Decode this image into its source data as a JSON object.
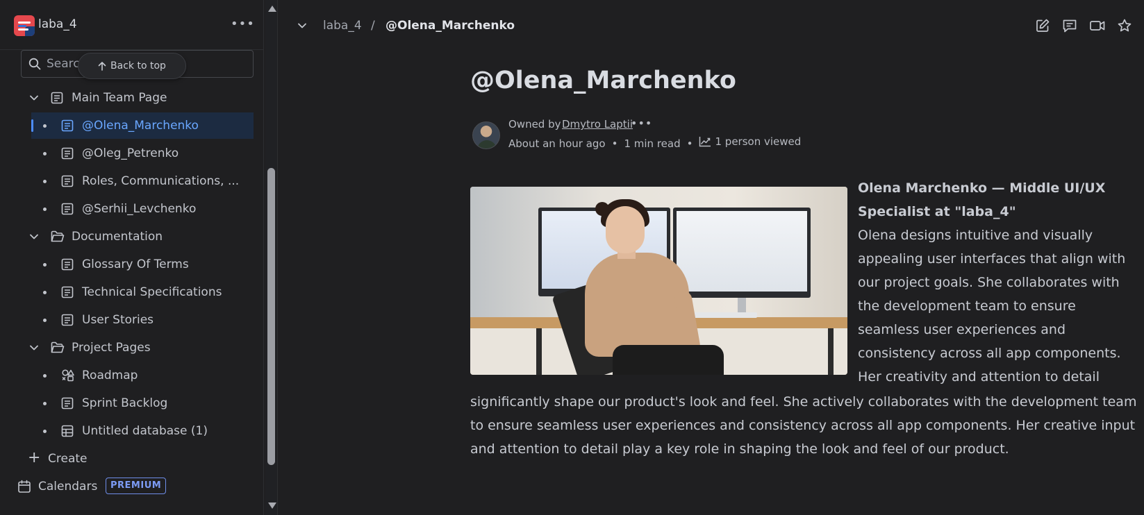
{
  "sidebar": {
    "space_name": "laba_4",
    "more_label": "•••",
    "search_placeholder": "Search",
    "back_to_top": "Back to top",
    "tree": [
      {
        "label": "Main Team Page"
      },
      {
        "label": "@Olena_Marchenko"
      },
      {
        "label": "@Oleg_Petrenko"
      },
      {
        "label": "Roles, Communications, ..."
      },
      {
        "label": "@Serhii_Levchenko"
      },
      {
        "label": "Documentation"
      },
      {
        "label": "Glossary Of Terms"
      },
      {
        "label": "Technical Specifications"
      },
      {
        "label": "User Stories"
      },
      {
        "label": "Project Pages"
      },
      {
        "label": "Roadmap"
      },
      {
        "label": "Sprint Backlog"
      },
      {
        "label": "Untitled database (1)"
      }
    ],
    "create_label": "Create",
    "calendars_label": "Calendars",
    "premium_badge": "PREMIUM"
  },
  "breadcrumb": {
    "space": "laba_4",
    "separator": "/",
    "current": "@Olena_Marchenko"
  },
  "page": {
    "title": "@Olena_Marchenko",
    "owned_by": "Owned by",
    "owner": "Dmytro Laptii",
    "owner_more": "•••",
    "updated": "About an hour ago",
    "read_time": "1 min read",
    "views": "1 person viewed",
    "meta_dot": "•",
    "bio_heading": "Olena Marchenko — Middle UI/UX Specialist at \"laba_4\"",
    "bio_side": "Olena designs intuitive and visually appealing user interfaces that align with our project goals. She collaborates with the development team to ensure seamless user experiences and consistency across all app components. Her creativity and attention to detail",
    "bio_wide": "significantly shape our product's look and feel. She actively collaborates with the development team to ensure seamless user experiences and consistency across all app components. Her creative input and attention to detail play a key role in shaping the look and feel of our product."
  },
  "colors": {
    "background": "#1f1f21",
    "accent": "#6aa7ff",
    "selected_bg": "#1c2b41",
    "premium": "#7c9bf4"
  }
}
